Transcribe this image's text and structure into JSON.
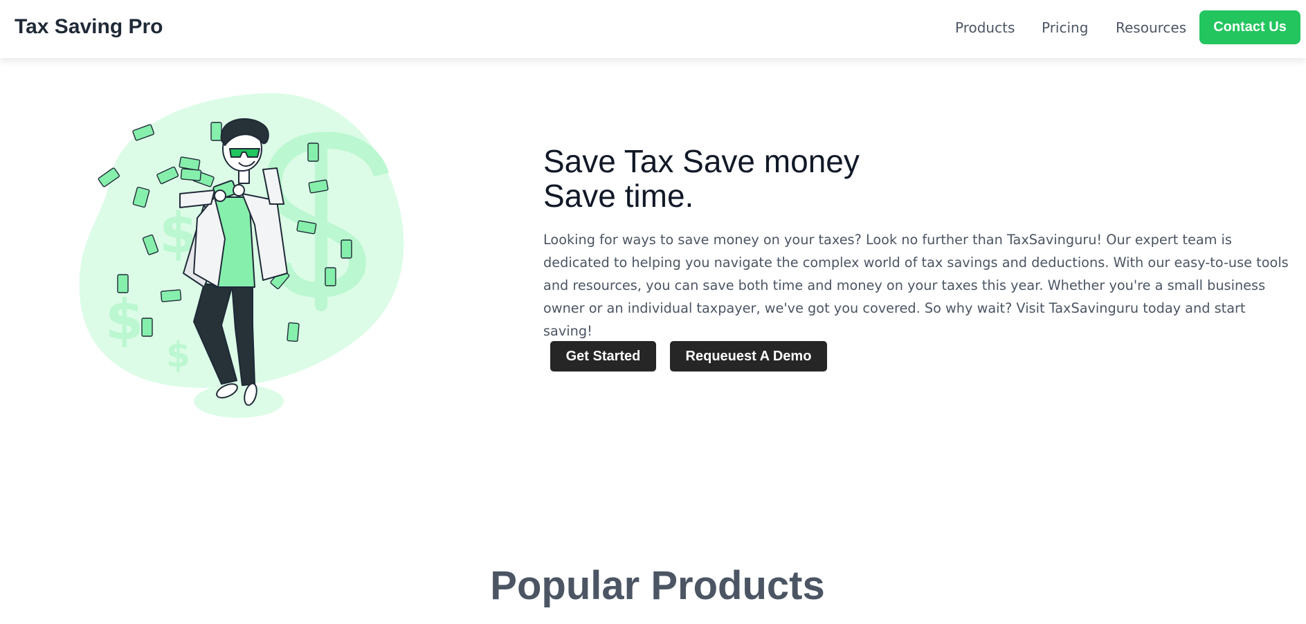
{
  "header": {
    "brand": "Tax Saving Pro",
    "nav": {
      "products": "Products",
      "pricing": "Pricing",
      "resources": "Resources",
      "contact": "Contact Us"
    }
  },
  "hero": {
    "title_line1": "Save Tax Save money",
    "title_line2": "Save time.",
    "description": "Looking for ways to save money on your taxes? Look no further than TaxSavinguru! Our expert team is dedicated to helping you navigate the complex world of tax savings and deductions. With our easy-to-use tools and resources, you can save both time and money on your taxes this year. Whether you're a small business owner or an individual taxpayer, we've got you covered. So why wait? Visit TaxSavinguru today and start saving!",
    "get_started": "Get Started",
    "request_demo": "Requeuest A Demo",
    "illustration": "man-throwing-money-illustration"
  },
  "products": {
    "title": "Popular Products"
  },
  "colors": {
    "accent": "#22c55e",
    "dark_button": "#262626",
    "light_green": "#dcfce7",
    "mid_green": "#bbf7d0",
    "text": "#4b5563"
  }
}
